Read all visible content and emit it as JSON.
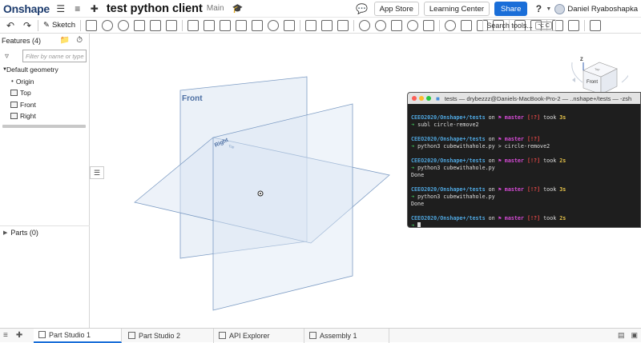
{
  "header": {
    "logo": "Onshape",
    "doc_title": "test python client",
    "branch": "Main",
    "app_store": "App Store",
    "learning_center": "Learning Center",
    "share": "Share",
    "help": "?",
    "user": "Daniel Ryaboshapka"
  },
  "toolbar": {
    "sketch": "Sketch",
    "search_tools": "Search tools...",
    "shortcut": "⌥ C"
  },
  "panel": {
    "features_header": "Features (4)",
    "filter_placeholder": "Filter by name or type",
    "tree": [
      "Default geometry",
      "Origin",
      "Top",
      "Front",
      "Right"
    ],
    "parts_header": "Parts (0)"
  },
  "viewport": {
    "front_label": "Front",
    "right_label": "Right",
    "top_label": "Top",
    "cube_face": "Front",
    "cube_top": "Top",
    "axis_z": "Z"
  },
  "terminal": {
    "title": "tests — drybezzz@Daniels-MacBook-Pro-2 — ..nshape+/tests — -zsh",
    "prompts": [
      {
        "path": "CEEO2020/Onshape+/tests",
        "branch": "master",
        "flags": "[!?]",
        "took": "took",
        "time": "3s",
        "command": "subl circle-remove2",
        "output": ""
      },
      {
        "path": "CEEO2020/Onshape+/tests",
        "branch": "master",
        "flags": "[!?]",
        "took": "",
        "time": "",
        "command": "python3 cubewithahole.py > circle-remove2",
        "output": ""
      },
      {
        "path": "CEEO2020/Onshape+/tests",
        "branch": "master",
        "flags": "[!?]",
        "took": "took",
        "time": "2s",
        "command": "python3 cubewithahole.py",
        "output": "Done"
      },
      {
        "path": "CEEO2020/Onshape+/tests",
        "branch": "master",
        "flags": "[!?]",
        "took": "took",
        "time": "3s",
        "command": "python3 cubewithahole.py",
        "output": "Done"
      },
      {
        "path": "CEEO2020/Onshape+/tests",
        "branch": "master",
        "flags": "[!?]",
        "took": "took",
        "time": "2s",
        "command": "",
        "output": ""
      }
    ],
    "on_word": "on"
  },
  "tabs": [
    {
      "label": "Part Studio 1",
      "active": true
    },
    {
      "label": "Part Studio 2",
      "active": false
    },
    {
      "label": "API Explorer",
      "active": false
    },
    {
      "label": "Assembly 1",
      "active": false
    }
  ],
  "colors": {
    "accent": "#1a6ed8",
    "plane_fill": "#dbe6f3",
    "plane_stroke": "#7d9cc4",
    "terminal_bg": "#1e1e1e"
  }
}
